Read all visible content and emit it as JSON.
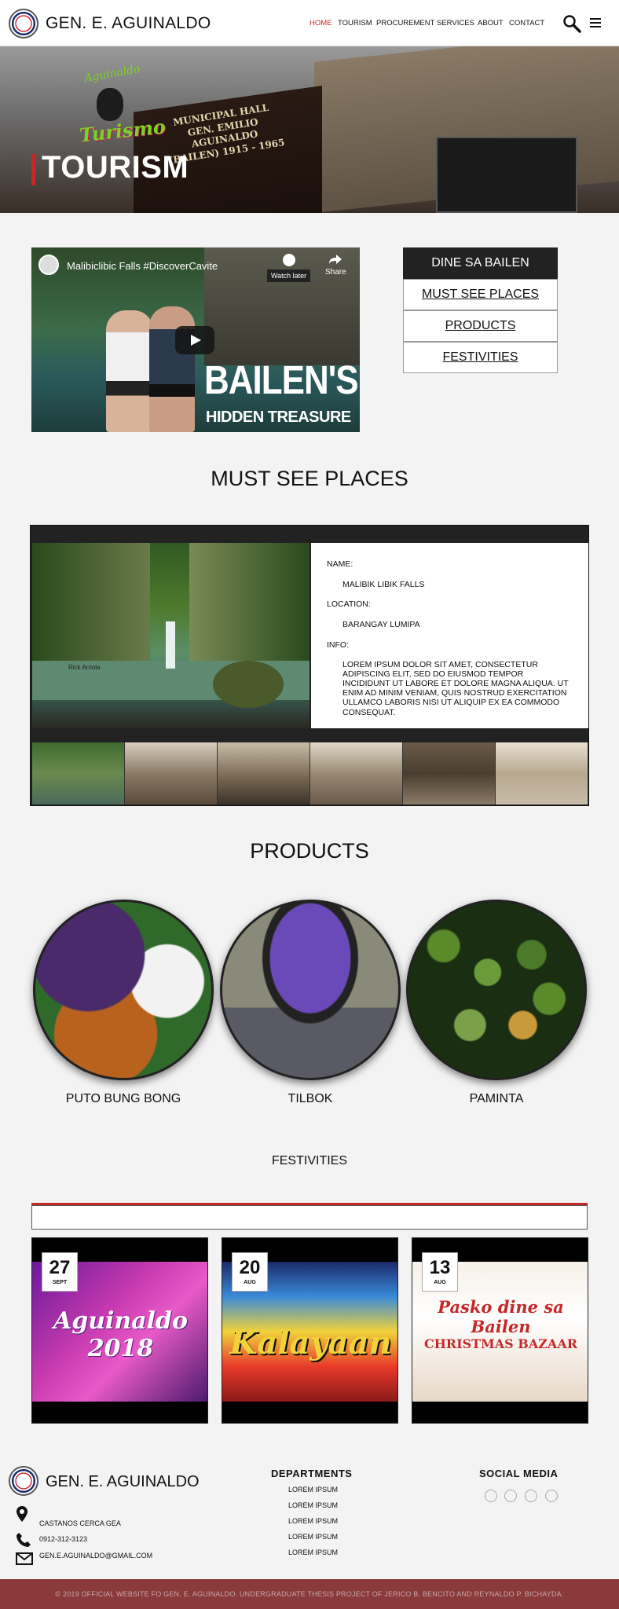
{
  "header": {
    "brand": "GEN. E. AGUINALDO",
    "nav": [
      "HOME",
      "TOURISM",
      "PROCUREMENT",
      "SERVICES",
      "ABOUT",
      "CONTACT"
    ],
    "active_color": "#c62828"
  },
  "hero": {
    "title": "TOURISM",
    "plaque": "MUNICIPAL HALL GEN. EMILIO AGUINALDO (BAILEN) 1915 - 1965",
    "logo_script_top": "Aguinaldo",
    "logo_script": "Turismo"
  },
  "video": {
    "title": "Malibiclibic Falls #DiscoverCavite",
    "watch_later": "Watch later",
    "share": "Share",
    "overlay_big": "BAILEN'S",
    "overlay_small": "HIDDEN TREASURE"
  },
  "side_menu": [
    "DINE SA BAILEN",
    "MUST SEE PLACES",
    "PRODUCTS",
    "FESTIVITIES"
  ],
  "must_see": {
    "heading": "MUST SEE PLACES",
    "name_label": "NAME:",
    "name": "MALIBIK LIBIK FALLS",
    "location_label": "LOCATION:",
    "location": "BARANGAY LUMIPA",
    "info_label": "INFO:",
    "info": "LOREM IPSUM DOLOR SIT AMET, CONSECTETUR ADIPISCING ELIT, SED DO EIUSMOD TEMPOR INCIDIDUNT UT LABORE ET DOLORE MAGNA ALIQUA. UT ENIM AD MINIM VENIAM, QUIS NOSTRUD EXERCITATION ULLAMCO LABORIS NISI UT ALIQUIP EX EA COMMODO CONSEQUAT.",
    "photo_credit": "Rick Arriola"
  },
  "products": {
    "heading": "PRODUCTS",
    "items": [
      "PUTO BUNG BONG",
      "TILBOK",
      "PAMINTA"
    ]
  },
  "festivities": {
    "heading": "FESTIVITIES",
    "cards": [
      {
        "day": "27",
        "month": "SEPT",
        "poster": "Aguinaldo 2018"
      },
      {
        "day": "20",
        "month": "AUG",
        "poster": "Kalayaan"
      },
      {
        "day": "13",
        "month": "AUG",
        "poster": "Pasko dine sa Bailen",
        "poster_sub": "CHRISTMAS BAZAAR"
      }
    ]
  },
  "footer": {
    "brand": "GEN. E. AGUINALDO",
    "address": "CASTANOS CERCA GEA",
    "phone": "0912-312-3123",
    "email": "GEN.E.AGUINALDO@GMAIL.COM",
    "departments_heading": "DEPARTMENTS",
    "departments": [
      "LOREM IPSUM",
      "LOREM IPSUM",
      "LOREM IPSUM",
      "LOREM IPSUM",
      "LOREM IPSUM"
    ],
    "social_heading": "SOCIAL MEDIA",
    "social_icons": [
      "twitter-icon",
      "instagram-icon",
      "facebook-icon",
      "google-plus-icon"
    ],
    "copyright": "© 2019 OFFICIAL WEBSITE FO GEN. E. AGUINALDO. UNDERGRADUATE THESIS PROJECT OF JERICO B. BENCITO AND REYNALDO P. BICHAYDA."
  }
}
